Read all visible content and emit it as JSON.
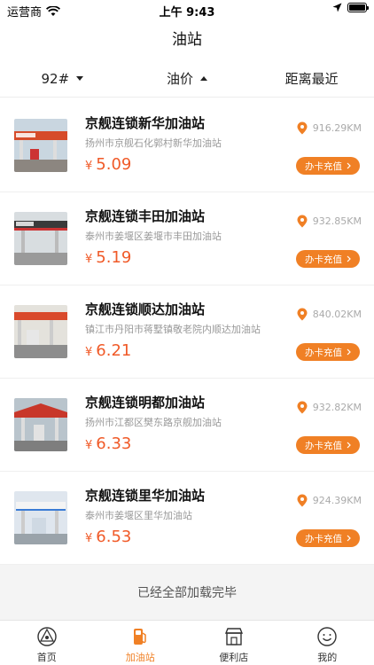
{
  "status_bar": {
    "carrier": "运营商",
    "time": "上午 9:43"
  },
  "nav": {
    "title": "油站"
  },
  "filters": {
    "oil_type": "92#",
    "price_sort": "油价",
    "distance_sort": "距离最近"
  },
  "stations": [
    {
      "name": "京舰连锁新华加油站",
      "address": "扬州市京舰石化郭村新华加油站",
      "price": "5.09",
      "distance": "916.29KM"
    },
    {
      "name": "京舰连锁丰田加油站",
      "address": "泰州市姜堰区姜堰市丰田加油站",
      "price": "5.19",
      "distance": "932.85KM"
    },
    {
      "name": "京舰连锁顺达加油站",
      "address": "镇江市丹阳市蒋墅镇敬老院内顺达加油站",
      "price": "6.21",
      "distance": "840.02KM"
    },
    {
      "name": "京舰连锁明都加油站",
      "address": "扬州市江都区樊东路京舰加油站",
      "price": "6.33",
      "distance": "932.82KM"
    },
    {
      "name": "京舰连锁里华加油站",
      "address": "泰州市姜堰区里华加油站",
      "price": "6.53",
      "distance": "924.39KM"
    }
  ],
  "currency_symbol": "¥",
  "card_button_label": "办卡充值",
  "footer_message": "已经全部加载完毕",
  "tabs": [
    {
      "label": "首页",
      "icon": "home-icon"
    },
    {
      "label": "加油站",
      "icon": "fuel-pump-icon"
    },
    {
      "label": "便利店",
      "icon": "store-icon"
    },
    {
      "label": "我的",
      "icon": "profile-icon"
    }
  ],
  "colors": {
    "accent": "#f08025",
    "price": "#f05a28"
  }
}
